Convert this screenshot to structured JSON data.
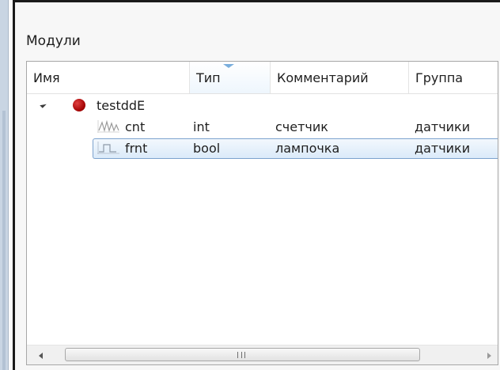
{
  "panel": {
    "title": "Модули"
  },
  "table": {
    "columns": [
      {
        "label": "Имя"
      },
      {
        "label": "Тип",
        "sorted": true
      },
      {
        "label": "Комментарий"
      },
      {
        "label": "Группа"
      }
    ],
    "group": {
      "name": "testddE",
      "expanded": true,
      "status_color": "#c00000"
    },
    "rows": [
      {
        "name": "cnt",
        "type": "int",
        "comment": "счетчик",
        "group": "датчики",
        "icon": "analog-signal-icon",
        "selected": false
      },
      {
        "name": "frnt",
        "type": "bool",
        "comment": "лампочка",
        "group": "датчики",
        "icon": "discrete-signal-icon",
        "selected": true
      }
    ]
  },
  "colors": {
    "selection_border": "#7da2ce",
    "selection_fill": "#dbeaf9",
    "sort_arrow": "#7aaedc"
  }
}
